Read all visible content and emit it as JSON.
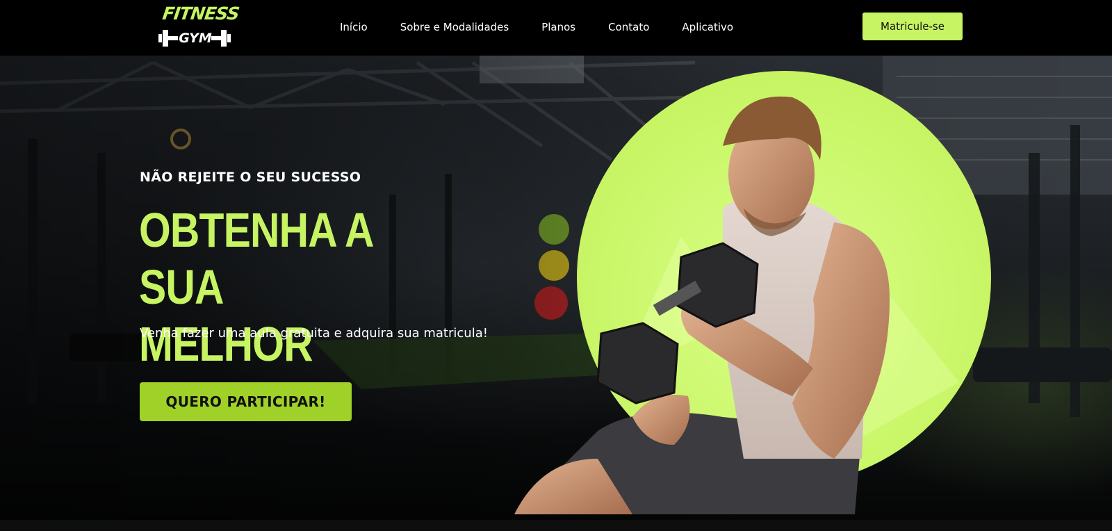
{
  "brand": {
    "logo_line1": "FITNESS",
    "logo_line2": "GYM",
    "accent_color": "#c6f462"
  },
  "nav": {
    "items": [
      {
        "label": "Início"
      },
      {
        "label": "Sobre e Modalidades"
      },
      {
        "label": "Planos"
      },
      {
        "label": "Contato"
      },
      {
        "label": "Aplicativo"
      }
    ],
    "cta_label": "Matricule-se"
  },
  "hero": {
    "eyebrow": "NÃO REJEITE O SEU SUCESSO",
    "title_line1": "OBTENHA A SUA",
    "title_line2": "MELHOR FORMA",
    "subtitle": "Venha fazer uma aula gratuita e adquira sua matricula!",
    "cta_label": "QUERO PARTICIPAR!",
    "cta_color": "#9fd129",
    "background_image": "gym-interior-photo",
    "feature_image": "man-lifting-dumbbell-photo"
  }
}
